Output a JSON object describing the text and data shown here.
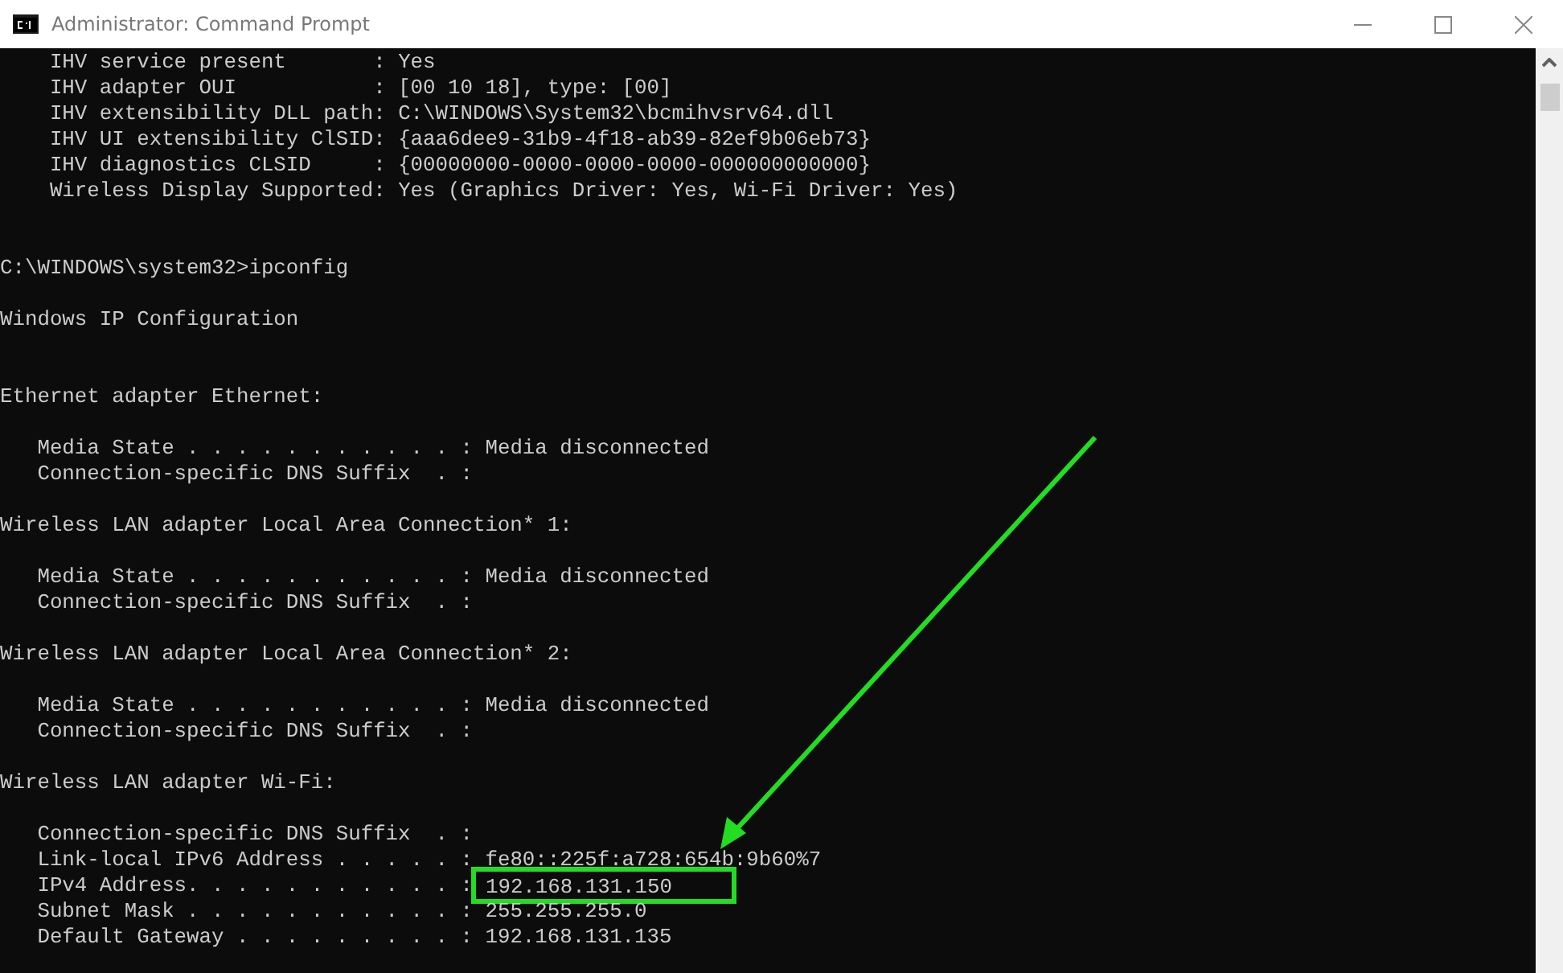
{
  "window": {
    "title": "Administrator: Command Prompt"
  },
  "lines": [
    {
      "kind": "pair",
      "label": "    IHV service present       :",
      "value": "Yes",
      "highlighted": false
    },
    {
      "kind": "pair",
      "label": "    IHV adapter OUI           :",
      "value": "[00 10 18], type: [00]",
      "highlighted": false
    },
    {
      "kind": "pair",
      "label": "    IHV extensibility DLL path:",
      "value": "C:\\WINDOWS\\System32\\bcmihvsrv64.dll",
      "highlighted": false
    },
    {
      "kind": "pair",
      "label": "    IHV UI extensibility ClSID:",
      "value": "{aaa6dee9-31b9-4f18-ab39-82ef9b06eb73}",
      "highlighted": false
    },
    {
      "kind": "pair",
      "label": "    IHV diagnostics CLSID     :",
      "value": "{00000000-0000-0000-0000-000000000000}",
      "highlighted": false
    },
    {
      "kind": "pair",
      "label": "    Wireless Display Supported:",
      "value": "Yes (Graphics Driver: Yes, Wi-Fi Driver: Yes)",
      "highlighted": false
    },
    {
      "kind": "blank"
    },
    {
      "kind": "blank"
    },
    {
      "kind": "text",
      "text": "C:\\WINDOWS\\system32>ipconfig"
    },
    {
      "kind": "blank"
    },
    {
      "kind": "text",
      "text": "Windows IP Configuration"
    },
    {
      "kind": "blank"
    },
    {
      "kind": "blank"
    },
    {
      "kind": "text",
      "text": "Ethernet adapter Ethernet:"
    },
    {
      "kind": "blank"
    },
    {
      "kind": "pair",
      "label": "   Media State . . . . . . . . . . . :",
      "value": "Media disconnected",
      "highlighted": false
    },
    {
      "kind": "text",
      "text": "   Connection-specific DNS Suffix  . :"
    },
    {
      "kind": "blank"
    },
    {
      "kind": "text",
      "text": "Wireless LAN adapter Local Area Connection* 1:"
    },
    {
      "kind": "blank"
    },
    {
      "kind": "pair",
      "label": "   Media State . . . . . . . . . . . :",
      "value": "Media disconnected",
      "highlighted": false
    },
    {
      "kind": "text",
      "text": "   Connection-specific DNS Suffix  . :"
    },
    {
      "kind": "blank"
    },
    {
      "kind": "text",
      "text": "Wireless LAN adapter Local Area Connection* 2:"
    },
    {
      "kind": "blank"
    },
    {
      "kind": "pair",
      "label": "   Media State . . . . . . . . . . . :",
      "value": "Media disconnected",
      "highlighted": false
    },
    {
      "kind": "text",
      "text": "   Connection-specific DNS Suffix  . :"
    },
    {
      "kind": "blank"
    },
    {
      "kind": "text",
      "text": "Wireless LAN adapter Wi-Fi:"
    },
    {
      "kind": "blank"
    },
    {
      "kind": "text",
      "text": "   Connection-specific DNS Suffix  . :"
    },
    {
      "kind": "pair",
      "label": "   Link-local IPv6 Address . . . . . :",
      "value": "fe80::225f:a728:654b:9b60%7",
      "highlighted": false
    },
    {
      "kind": "pair",
      "label": "   IPv4 Address. . . . . . . . . . . :",
      "value": "192.168.131.150",
      "highlighted": true
    },
    {
      "kind": "pair",
      "label": "   Subnet Mask . . . . . . . . . . . :",
      "value": "255.255.255.0",
      "highlighted": false
    },
    {
      "kind": "pair",
      "label": "   Default Gateway . . . . . . . . . :",
      "value": "192.168.131.135",
      "highlighted": false
    }
  ]
}
